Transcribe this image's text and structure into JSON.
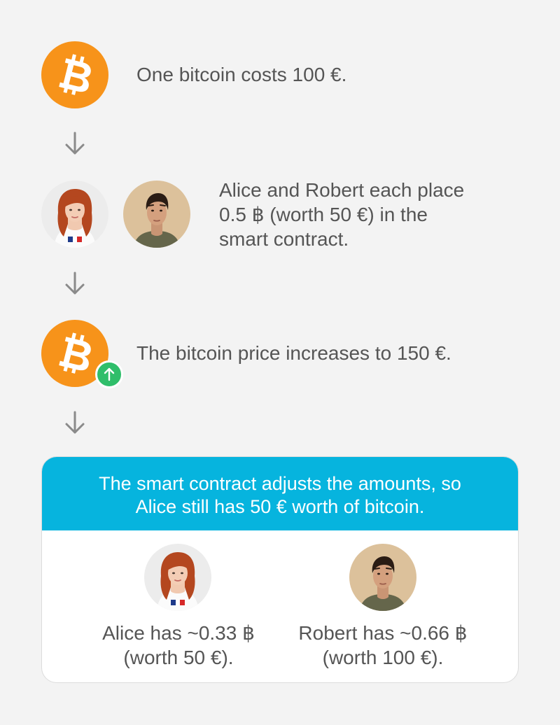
{
  "steps": {
    "step1": {
      "text": "One bitcoin costs 100 €.",
      "icon": "bitcoin-icon"
    },
    "step2": {
      "lines": [
        "Alice and Robert each place",
        "0.5 ฿ (worth 50 €) in the",
        "smart contract."
      ],
      "icons": [
        "alice-avatar",
        "robert-avatar"
      ]
    },
    "step3": {
      "text": "The bitcoin price increases to 150 €.",
      "icon": "bitcoin-icon",
      "badge": "arrow-up-icon"
    }
  },
  "result": {
    "header_lines": [
      "The smart contract adjusts the amounts, so",
      "Alice still has 50 € worth of bitcoin."
    ],
    "alice_lines": [
      "Alice has ~0.33 ฿",
      "(worth 50 €)."
    ],
    "robert_lines": [
      "Robert has ~0.66 ฿",
      "(worth 100 €)."
    ]
  },
  "colors": {
    "background": "#f3f3f3",
    "bitcoin_orange": "#f7931a",
    "header_blue": "#06b4de",
    "badge_green": "#2fbe6a",
    "text_gray": "#555555",
    "arrow_gray": "#8a8a8a"
  }
}
